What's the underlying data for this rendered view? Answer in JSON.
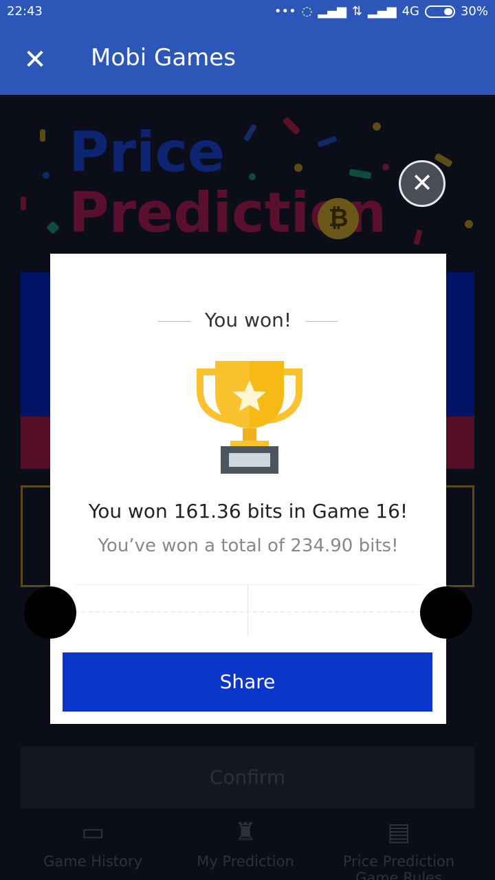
{
  "status_bar": {
    "time": "22:43",
    "network": "4G",
    "battery": "30%"
  },
  "app_bar": {
    "title": "Mobi Games",
    "close_icon": "close-icon"
  },
  "background": {
    "hero_line1": "Price",
    "hero_line2": "Prediction",
    "confirm_label": "Confirm",
    "nav": [
      {
        "label": "Game History",
        "icon": "chart-icon"
      },
      {
        "label": "My Prediction",
        "icon": "trophy-icon"
      },
      {
        "label": "Price Prediction Game Rules",
        "icon": "document-icon"
      }
    ]
  },
  "modal": {
    "header": "You won!",
    "message": "You won 161.36 bits in Game 16!",
    "total": "You’ve won a total of 234.90 bits!",
    "share_label": "Share",
    "close_icon": "close-icon"
  },
  "colors": {
    "app_bar": "#2c57b8",
    "share_button": "#0a36cc",
    "trophy_gold": "#f9c22e",
    "trophy_base": "#4a5660"
  }
}
